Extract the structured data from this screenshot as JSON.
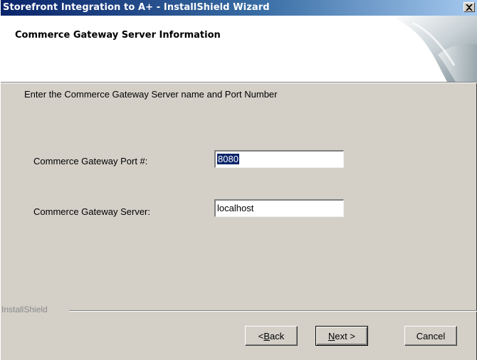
{
  "window": {
    "title": "Storefront Integration to A+ - InstallShield Wizard",
    "close_glyph": "×",
    "colors": {
      "titlebar_start": "#0a246a",
      "titlebar_end": "#a6caf0",
      "face": "#d4d0c8"
    }
  },
  "header": {
    "title": "Commerce Gateway Server Information",
    "graphic_icon": "installshield-swirl-icon"
  },
  "main": {
    "instructions": "Enter the Commerce Gateway Server name and Port Number",
    "port_field": {
      "label": "Commerce Gateway Port #:",
      "value": "8080",
      "selected": true
    },
    "server_field": {
      "label": "Commerce Gateway Server:",
      "value": "localhost"
    }
  },
  "footer": {
    "brand": "InstallShield",
    "buttons": {
      "back": {
        "prefix": "< ",
        "mnemonic": "B",
        "rest": "ack"
      },
      "next": {
        "mnemonic": "N",
        "rest": "ext >"
      },
      "cancel": "Cancel"
    }
  }
}
